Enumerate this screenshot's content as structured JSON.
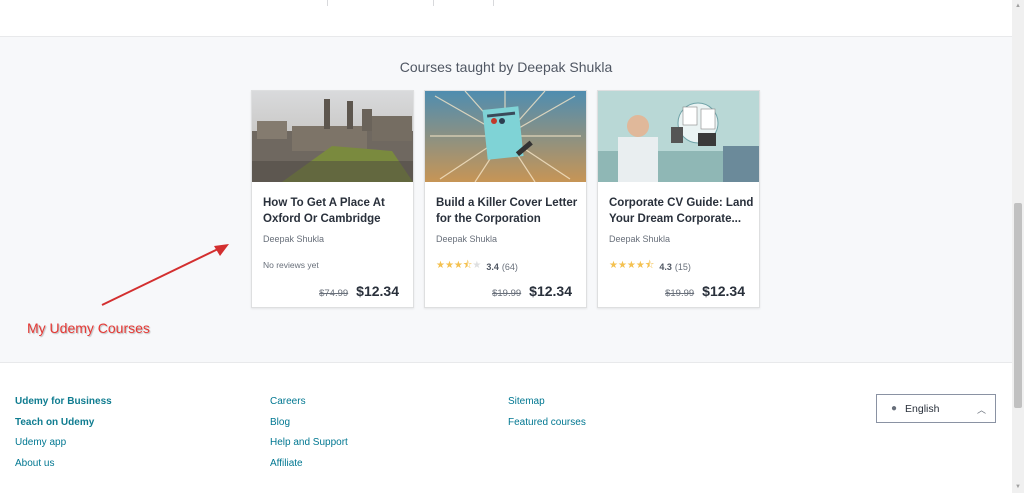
{
  "section": {
    "title": "Courses taught by Deepak Shukla"
  },
  "courses": [
    {
      "title": "How To Get A Place At Oxford Or Cambridge",
      "author": "Deepak Shukla",
      "reviews": "No reviews yet",
      "old_price": "$74.99",
      "price": "$12.34"
    },
    {
      "title": "Build a Killer Cover Letter for the Corporation",
      "author": "Deepak Shukla",
      "rating": "3.4",
      "rating_count": "(64)",
      "stars": 3.5,
      "old_price": "$19.99",
      "price": "$12.34"
    },
    {
      "title": "Corporate CV Guide: Land Your Dream Corporate...",
      "author": "Deepak Shukla",
      "rating": "4.3",
      "rating_count": "(15)",
      "stars": 4.5,
      "old_price": "$19.99",
      "price": "$12.34"
    }
  ],
  "annotation": {
    "text": "My Udemy Courses",
    "color": "#e53935"
  },
  "footer": {
    "col1": [
      "Udemy for Business",
      "Teach on Udemy",
      "Udemy app",
      "About us"
    ],
    "col2": [
      "Careers",
      "Blog",
      "Help and Support",
      "Affiliate"
    ],
    "col3": [
      "Sitemap",
      "Featured courses"
    ],
    "language": "English"
  },
  "colors": {
    "link": "#007791",
    "star": "#f4c150",
    "section_bg": "#f7f8fa"
  }
}
